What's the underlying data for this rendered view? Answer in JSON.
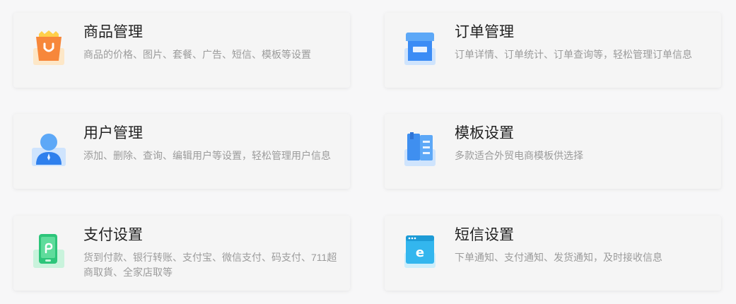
{
  "cards": [
    {
      "title": "商品管理",
      "desc": "商品的价格、图片、套餐、广告、短信、模板等设置",
      "icon": "shopping-bag-icon",
      "color": "#f7873a"
    },
    {
      "title": "订单管理",
      "desc": "订单详情、订单统计、订单查询等，轻松管理订单信息",
      "icon": "storefront-icon",
      "color": "#3b8cf5"
    },
    {
      "title": "用户管理",
      "desc": "添加、删除、查询、编辑用户等设置，轻松管理用户信息",
      "icon": "user-icon",
      "color": "#2f80ed"
    },
    {
      "title": "模板设置",
      "desc": "多款适合外贸电商模板供选择",
      "icon": "book-template-icon",
      "color": "#3f8ff0"
    },
    {
      "title": "支付设置",
      "desc": "货到付款、银行转账、支付宝、微信支付、码支付、711超商取貨、全家店取等",
      "icon": "payment-phone-icon",
      "color": "#2dc57a"
    },
    {
      "title": "短信设置",
      "desc": "下单通知、支付通知、发货通知，及时接收信息",
      "icon": "browser-window-icon",
      "color": "#33b6ee"
    }
  ]
}
